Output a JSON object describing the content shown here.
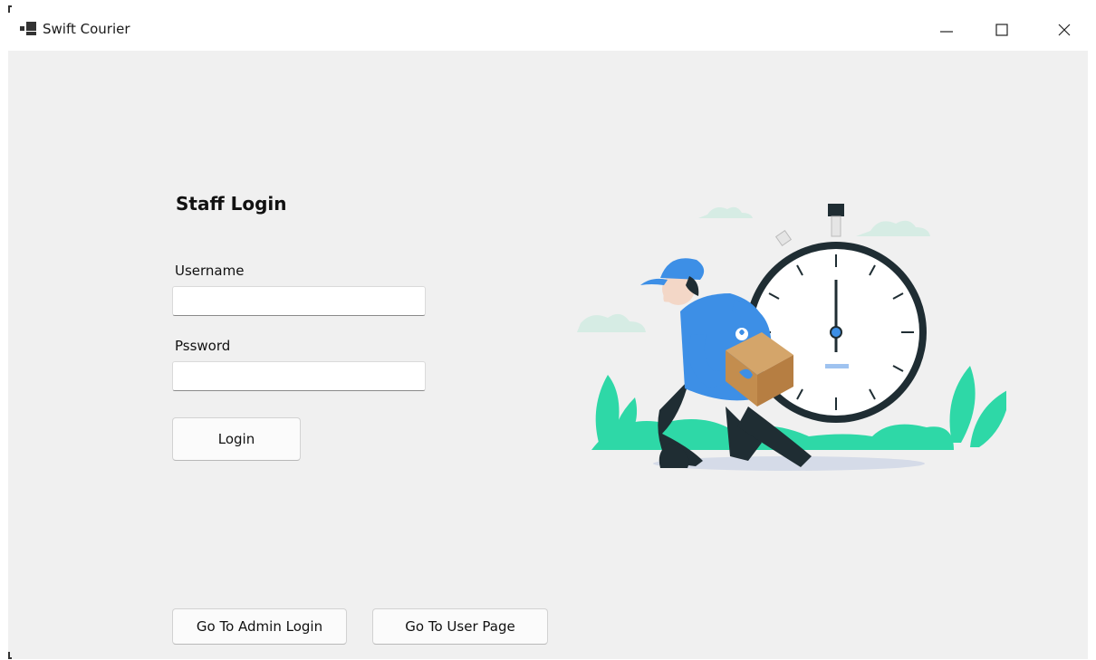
{
  "window": {
    "title": "Swift Courier"
  },
  "form": {
    "heading": "Staff Login",
    "username_label": "Username",
    "username_value": "",
    "password_label": "Pssword",
    "password_value": "",
    "login_button": "Login"
  },
  "footer": {
    "admin_button": "Go To Admin Login",
    "user_button": "Go To User Page"
  },
  "colors": {
    "client_bg": "#f0f0f0",
    "accent_green": "#2ed8a7",
    "courier_blue": "#3d8fe6",
    "clock_ring": "#1f2d33"
  },
  "icons": {
    "app": "app-icon",
    "minimize": "minimize-icon",
    "maximize": "maximize-icon",
    "close": "close-icon"
  }
}
